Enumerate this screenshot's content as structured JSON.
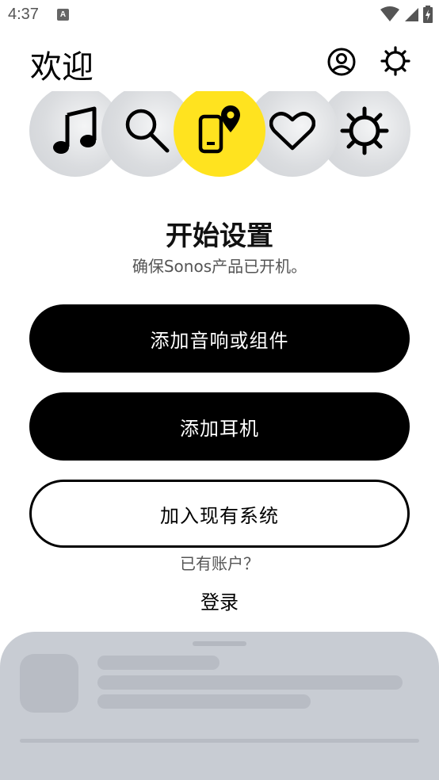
{
  "status_bar": {
    "time": "4:37",
    "app_icon_letter": "A",
    "icons": [
      "wifi-icon",
      "signal-icon",
      "battery-charging-icon"
    ]
  },
  "header": {
    "title": "欢迎",
    "account_icon": "account-icon",
    "settings_icon": "gear-icon"
  },
  "carousel": {
    "items": [
      {
        "icon": "music-note-icon",
        "active": false
      },
      {
        "icon": "search-icon",
        "active": false
      },
      {
        "icon": "phone-location-icon",
        "active": true
      },
      {
        "icon": "heart-icon",
        "active": false
      },
      {
        "icon": "gear-icon",
        "active": false
      }
    ],
    "active_color": "#ffe31f"
  },
  "setup": {
    "title": "开始设置",
    "subtitle": "确保Sonos产品已开机。"
  },
  "actions": {
    "add_speaker": "添加音响或组件",
    "add_headphones": "添加耳机",
    "join_system": "加入现有系统"
  },
  "account": {
    "question": "已有账户？",
    "login": "登录"
  },
  "colors": {
    "primary_button": "#000000",
    "accent": "#ffe31f",
    "sheet_bg": "#c8ccd3"
  }
}
